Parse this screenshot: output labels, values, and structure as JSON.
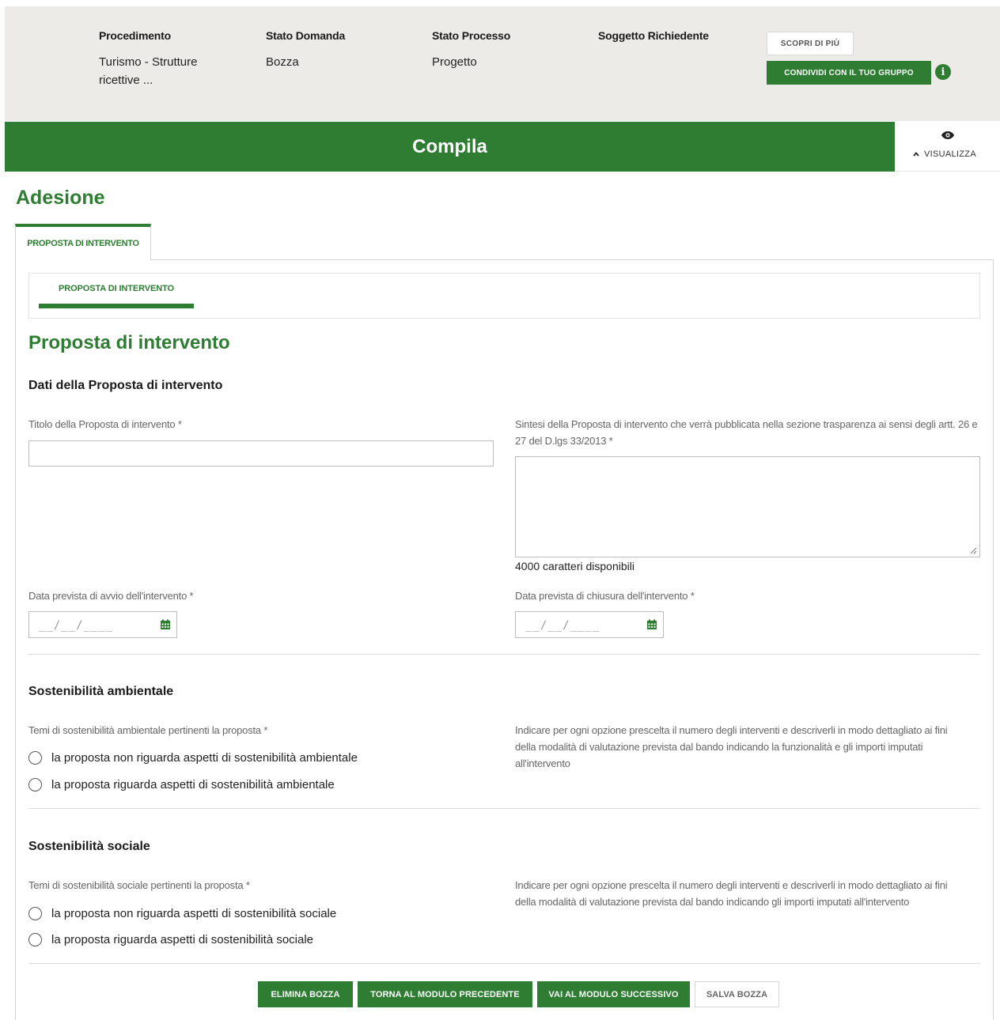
{
  "header": {
    "columns": [
      {
        "title": "Procedimento",
        "value": "Turismo - Strutture ricettive ..."
      },
      {
        "title": "Stato Domanda",
        "value": "Bozza"
      },
      {
        "title": "Stato Processo",
        "value": "Progetto"
      },
      {
        "title": "Soggetto Richiedente",
        "value": ""
      }
    ],
    "discover_label": "SCOPRI DI PIÙ",
    "share_label": "CONDIVIDI CON IL TUO GRUPPO",
    "info_icon_glyph": "i"
  },
  "banner": {
    "title": "Compila",
    "view_label": "VISUALIZZA"
  },
  "page": {
    "title": "Adesione",
    "tab_label": "PROPOSTA DI INTERVENTO",
    "subtab_label": "PROPOSTA DI INTERVENTO",
    "section_title": "Proposta di intervento"
  },
  "form": {
    "dati_title": "Dati della Proposta di intervento",
    "titolo_label": "Titolo della Proposta di intervento *",
    "titolo_value": "",
    "sintesi_label": "Sintesi della Proposta di intervento che verrà pubblicata nella sezione trasparenza ai sensi degli artt. 26 e 27 del D.lgs 33/2013 *",
    "sintesi_value": "",
    "sintesi_counter": "4000 caratteri disponibili",
    "avvio_label": "Data prevista di avvio dell'intervento *",
    "chiusura_label": "Data prevista di chiusura dell'intervento *",
    "date_placeholder": "__/__/____"
  },
  "ambientale": {
    "title": "Sostenibilità ambientale",
    "question": "Temi di sostenibilità ambientale pertinenti la proposta *",
    "options": [
      "la proposta non riguarda aspetti di sostenibilità ambientale",
      "la proposta riguarda aspetti di sostenibilità ambientale"
    ],
    "help": "Indicare per ogni opzione prescelta il numero degli interventi e descriverli in modo dettagliato ai fini della modalità di valutazione prevista dal bando indicando la funzionalità e gli importi imputati all'intervento"
  },
  "sociale": {
    "title": "Sostenibilità sociale",
    "question": "Temi di sostenibilità sociale pertinenti la proposta *",
    "options": [
      "la proposta non riguarda aspetti di sostenibilità sociale",
      "la proposta riguarda aspetti di sostenibilità sociale"
    ],
    "help": "Indicare per ogni opzione prescelta il numero degli interventi e descriverli in modo dettagliato ai fini della modalità di valutazione prevista dal bando indicando gli importi imputati all'intervento"
  },
  "footer": {
    "delete_label": "ELIMINA BOZZA",
    "prev_label": "TORNA AL MODULO PRECEDENTE",
    "next_label": "VAI AL MODULO SUCCESSIVO",
    "save_label": "SALVA BOZZA"
  },
  "colors": {
    "brand_green": "#2e7d32",
    "header_bg": "#ecebe8"
  },
  "icons": [
    "info-icon",
    "eye-icon",
    "chevron-up-icon",
    "calendar-icon",
    "resize-grip-icon"
  ]
}
